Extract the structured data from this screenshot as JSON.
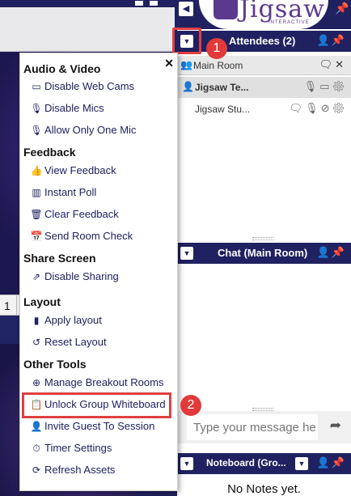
{
  "app": {
    "logo_text": "Jigsaw",
    "logo_subtext": "INTERACTIVE"
  },
  "background": {
    "page_number": "1"
  },
  "attendees_panel": {
    "title": "Attendees (2)",
    "room_label": "Main Room",
    "attendees": [
      {
        "name": "Jigsaw Te...",
        "bold": true
      },
      {
        "name": "Jigsaw Stu...",
        "bold": false
      }
    ]
  },
  "chat_panel": {
    "title": "Chat (Main Room)",
    "input_placeholder": "Type your message he"
  },
  "notes_panel": {
    "title": "Noteboard (Gro...",
    "empty_text": "No Notes yet."
  },
  "callouts": [
    "1",
    "2"
  ],
  "menu": {
    "sections": [
      {
        "title": "Audio & Video",
        "items": [
          {
            "label": "Disable Web Cams",
            "icon": "video-camera-icon"
          },
          {
            "label": "Disable Mics",
            "icon": "microphone-icon"
          },
          {
            "label": "Allow Only One Mic",
            "icon": "microphone-icon"
          }
        ]
      },
      {
        "title": "Feedback",
        "items": [
          {
            "label": "View Feedback",
            "icon": "thumbs-up-icon"
          },
          {
            "label": "Instant Poll",
            "icon": "bar-chart-icon"
          },
          {
            "label": "Clear Feedback",
            "icon": "trash-icon"
          },
          {
            "label": "Send Room Check",
            "icon": "calendar-check-icon"
          }
        ]
      },
      {
        "title": "Share Screen",
        "items": [
          {
            "label": "Disable Sharing",
            "icon": "share-square-icon"
          }
        ]
      },
      {
        "title": "Layout",
        "items": [
          {
            "label": "Apply layout",
            "icon": "bookmark-icon"
          },
          {
            "label": "Reset Layout",
            "icon": "undo-icon"
          }
        ]
      },
      {
        "title": "Other Tools",
        "items": [
          {
            "label": "Manage Breakout Rooms",
            "icon": "plus-circle-icon"
          },
          {
            "label": "Unlock Group Whiteboard",
            "icon": "clipboard-icon"
          },
          {
            "label": "Invite Guest To Session",
            "icon": "user-plus-icon"
          },
          {
            "label": "Timer Settings",
            "icon": "stopwatch-icon"
          },
          {
            "label": "Refresh Assets",
            "icon": "refresh-icon"
          }
        ]
      }
    ]
  },
  "colors": {
    "navy": "#1f2160",
    "callout_red": "#e03a3a",
    "logo_purple": "#5b3a8e"
  }
}
